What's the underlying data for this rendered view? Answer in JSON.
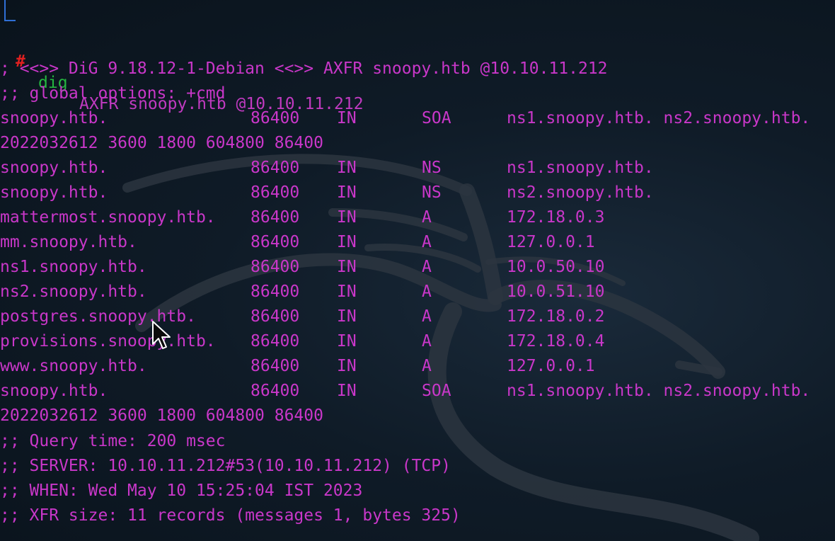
{
  "prompt": {
    "symbol": "#",
    "command": "dig",
    "arguments": "AXFR snoopy.htb @10.10.11.212"
  },
  "header_lines": [
    "; <<>> DiG 9.18.12-1-Debian <<>> AXFR snoopy.htb @10.10.11.212",
    ";; global options: +cmd"
  ],
  "records": [
    {
      "name": "snoopy.htb.",
      "ttl": "86400",
      "class": "IN",
      "type": "SOA",
      "data": "ns1.snoopy.htb. ns2.snoopy.htb."
    },
    {
      "continuation": "2022032612 3600 1800 604800 86400"
    },
    {
      "name": "snoopy.htb.",
      "ttl": "86400",
      "class": "IN",
      "type": "NS",
      "data": "ns1.snoopy.htb."
    },
    {
      "name": "snoopy.htb.",
      "ttl": "86400",
      "class": "IN",
      "type": "NS",
      "data": "ns2.snoopy.htb."
    },
    {
      "name": "mattermost.snoopy.htb.",
      "ttl": "86400",
      "class": "IN",
      "type": "A",
      "data": "172.18.0.3"
    },
    {
      "name": "mm.snoopy.htb.",
      "ttl": "86400",
      "class": "IN",
      "type": "A",
      "data": "127.0.0.1"
    },
    {
      "name": "ns1.snoopy.htb.",
      "ttl": "86400",
      "class": "IN",
      "type": "A",
      "data": "10.0.50.10"
    },
    {
      "name": "ns2.snoopy.htb.",
      "ttl": "86400",
      "class": "IN",
      "type": "A",
      "data": "10.0.51.10"
    },
    {
      "name": "postgres.snoopy.htb.",
      "ttl": "86400",
      "class": "IN",
      "type": "A",
      "data": "172.18.0.2"
    },
    {
      "name": "provisions.snoopy.htb.",
      "ttl": "86400",
      "class": "IN",
      "type": "A",
      "data": "172.18.0.4"
    },
    {
      "name": "www.snoopy.htb.",
      "ttl": "86400",
      "class": "IN",
      "type": "A",
      "data": "127.0.0.1"
    },
    {
      "name": "snoopy.htb.",
      "ttl": "86400",
      "class": "IN",
      "type": "SOA",
      "data": "ns1.snoopy.htb. ns2.snoopy.htb."
    },
    {
      "continuation": "2022032612 3600 1800 604800 86400"
    }
  ],
  "footer_lines": [
    ";; Query time: 200 msec",
    ";; SERVER: 10.10.11.212#53(10.10.11.212) (TCP)",
    ";; WHEN: Wed May 10 15:25:04 IST 2023",
    ";; XFR size: 11 records (messages 1, bytes 325)"
  ],
  "colors": {
    "output": "#c937c9",
    "command": "#25b640",
    "prompt_symbol": "#e02020",
    "background": "#0d1720"
  },
  "icons": {
    "background": "kali-dragon-watermark",
    "pointer": "mouse-pointer-icon"
  }
}
